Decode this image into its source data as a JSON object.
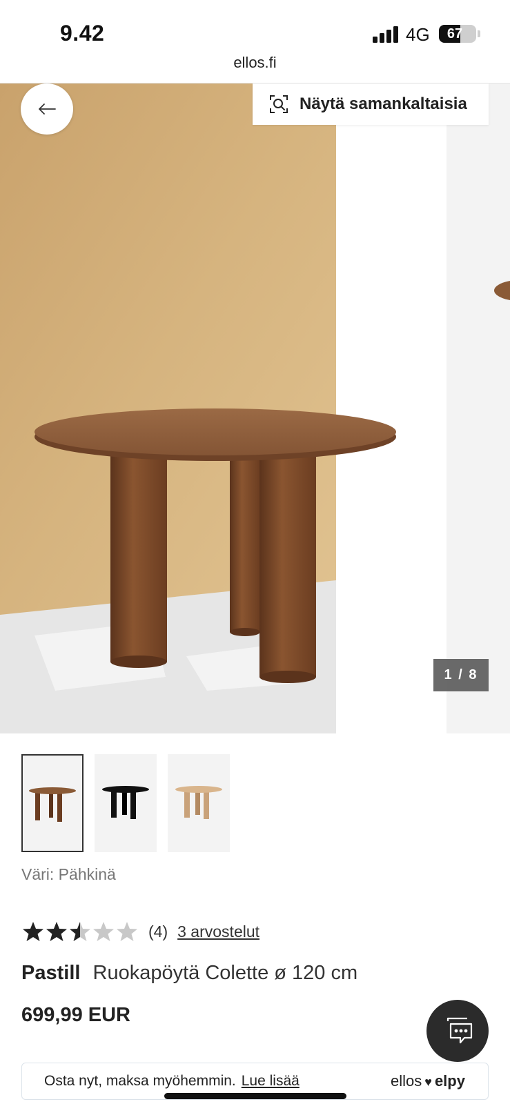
{
  "status_bar": {
    "time": "9.42",
    "network": "4G",
    "battery": "67",
    "battery_level": 0.67
  },
  "browser": {
    "url": "ellos.fi"
  },
  "gallery": {
    "back_label": "back",
    "similar_label": "Näytä samankaltaisia",
    "counter": "1 / 8",
    "current_index": 1,
    "total_images": 8,
    "thumbnail_colors": [
      "#7a4a2c",
      "#111111",
      "#c9a27a"
    ]
  },
  "product": {
    "color_line": "Väri: Pähkinä",
    "rating": 2.5,
    "rating_max": 5,
    "rating_count": "(4)",
    "reviews_link": "3 arvostelut",
    "brand": "Pastill",
    "name": "Ruokapöytä Colette ø 120 cm",
    "price": "699,99 EUR"
  },
  "paylater": {
    "text": "Osta nyt, maksa myöhemmin.",
    "link": "Lue lisää",
    "brand_left": "ellos",
    "brand_right": "elpy"
  },
  "colors": {
    "star_filled": "#222222",
    "star_empty": "#c8c8c8",
    "counter_bg": "#505050",
    "chat_bg": "#2b2b2b"
  }
}
